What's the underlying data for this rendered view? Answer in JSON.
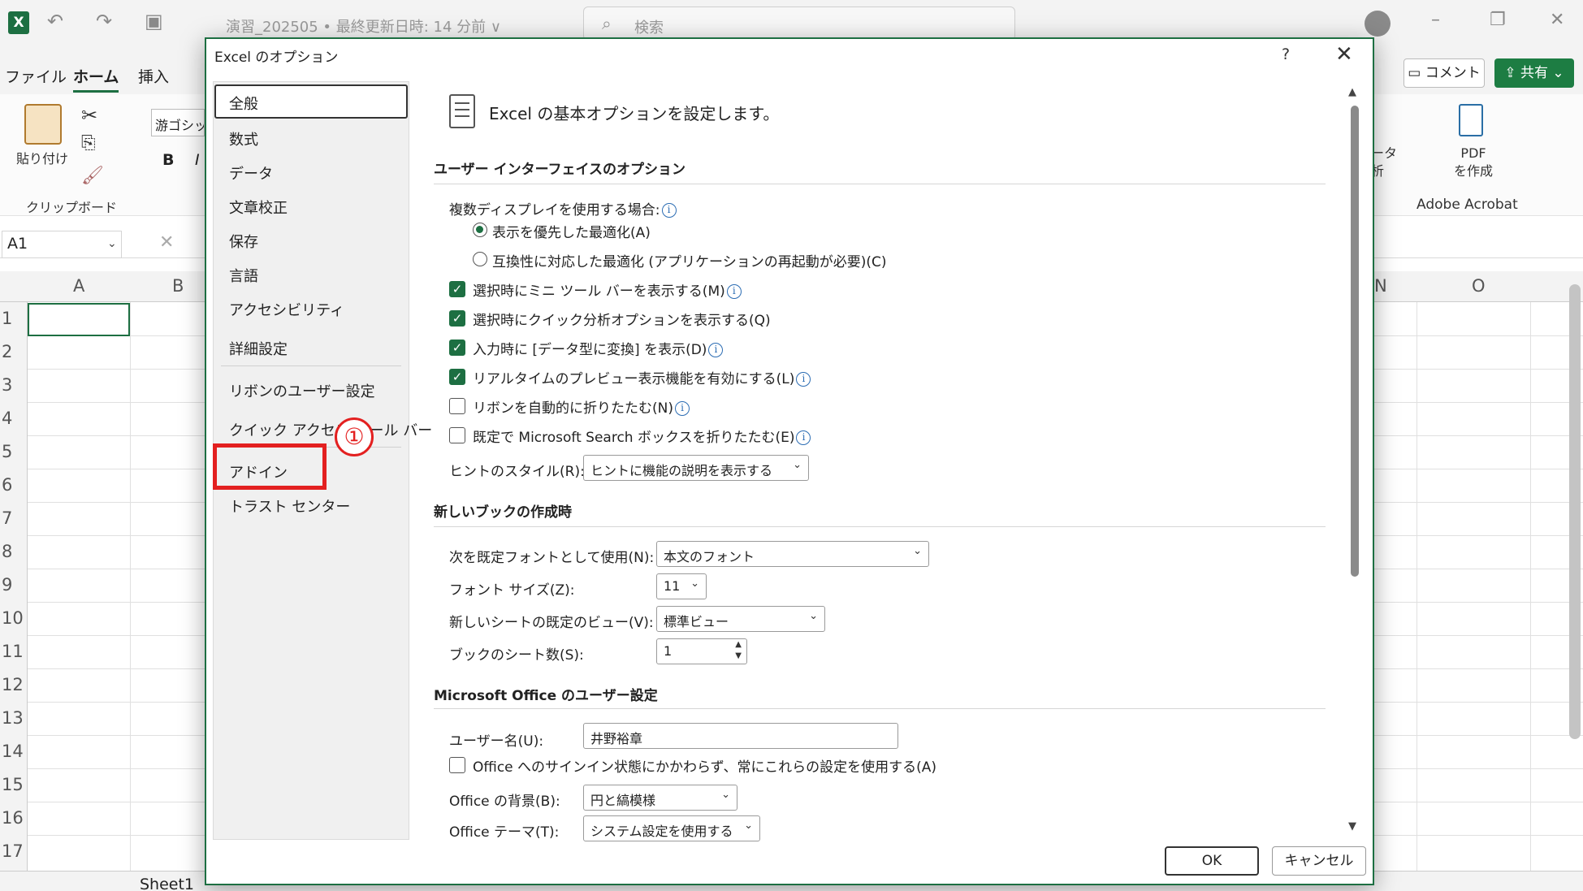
{
  "excel": {
    "document_title": "演習_202505 • 最終更新日時: 14 分前 ∨",
    "search_placeholder": "検索",
    "menu": [
      "ファイル",
      "ホーム",
      "挿入"
    ],
    "comment_label": "コメント",
    "share_label": "共有",
    "paste_label": "貼り付け",
    "clipboard_label": "クリップボード",
    "font_name": "游ゴシック",
    "bold_label": "B",
    "italic_label": "I",
    "pdf_label": "PDF\nを作成",
    "acrobat_label": "Adobe Acrobat",
    "partial_ribbon_label": "ータ\n析",
    "name_box": "A1",
    "columns": [
      "A",
      "B",
      "N",
      "O"
    ],
    "rows": [
      "1",
      "2",
      "3",
      "4",
      "5",
      "6",
      "7",
      "8",
      "9",
      "10",
      "11",
      "12",
      "13",
      "14",
      "15",
      "16",
      "17"
    ],
    "sheet_tab": "Sheet1"
  },
  "dialog": {
    "title": "Excel のオプション",
    "help": "?",
    "close": "✕",
    "nav": [
      "全般",
      "数式",
      "データ",
      "文章校正",
      "保存",
      "言語",
      "アクセシビリティ",
      "詳細設定",
      "リボンのユーザー設定",
      "クイック アクセス ツール バー",
      "アドイン",
      "トラスト センター"
    ],
    "annotation": "①",
    "heading": "Excel の基本オプションを設定します。",
    "ui_section": {
      "title": "ユーザー インターフェイスのオプション",
      "multi_display_label": "複数ディスプレイを使用する場合:",
      "radio_optimize_display": "表示を優先した最適化(A)",
      "radio_optimize_compat": "互換性に対応した最適化 (アプリケーションの再起動が必要)(C)",
      "chk_mini_toolbar": "選択時にミニ ツール バーを表示する(M)",
      "chk_quick_analysis": "選択時にクイック分析オプションを表示する(Q)",
      "chk_data_type": "入力時に [データ型に変換] を表示(D)",
      "chk_live_preview": "リアルタイムのプレビュー表示機能を有効にする(L)",
      "chk_collapse_ribbon": "リボンを自動的に折りたたむ(N)",
      "chk_collapse_search": "既定で Microsoft Search ボックスを折りたたむ(E)",
      "tooltip_label": "ヒントのスタイル(R):",
      "tooltip_value": "ヒントに機能の説明を表示する"
    },
    "book_section": {
      "title": "新しいブックの作成時",
      "font_label": "次を既定フォントとして使用(N):",
      "font_value": "本文のフォント",
      "size_label": "フォント サイズ(Z):",
      "size_value": "11",
      "view_label": "新しいシートの既定のビュー(V):",
      "view_value": "標準ビュー",
      "sheets_label": "ブックのシート数(S):",
      "sheets_value": "1"
    },
    "office_section": {
      "title": "Microsoft Office のユーザー設定",
      "username_label": "ユーザー名(U):",
      "username_value": "井野裕章",
      "chk_always_use": "Office へのサインイン状態にかかわらず、常にこれらの設定を使用する(A)",
      "background_label": "Office の背景(B):",
      "background_value": "円と縞模様",
      "theme_label": "Office テーマ(T):",
      "theme_value": "システム設定を使用する"
    },
    "ok_label": "OK",
    "cancel_label": "キャンセル"
  }
}
